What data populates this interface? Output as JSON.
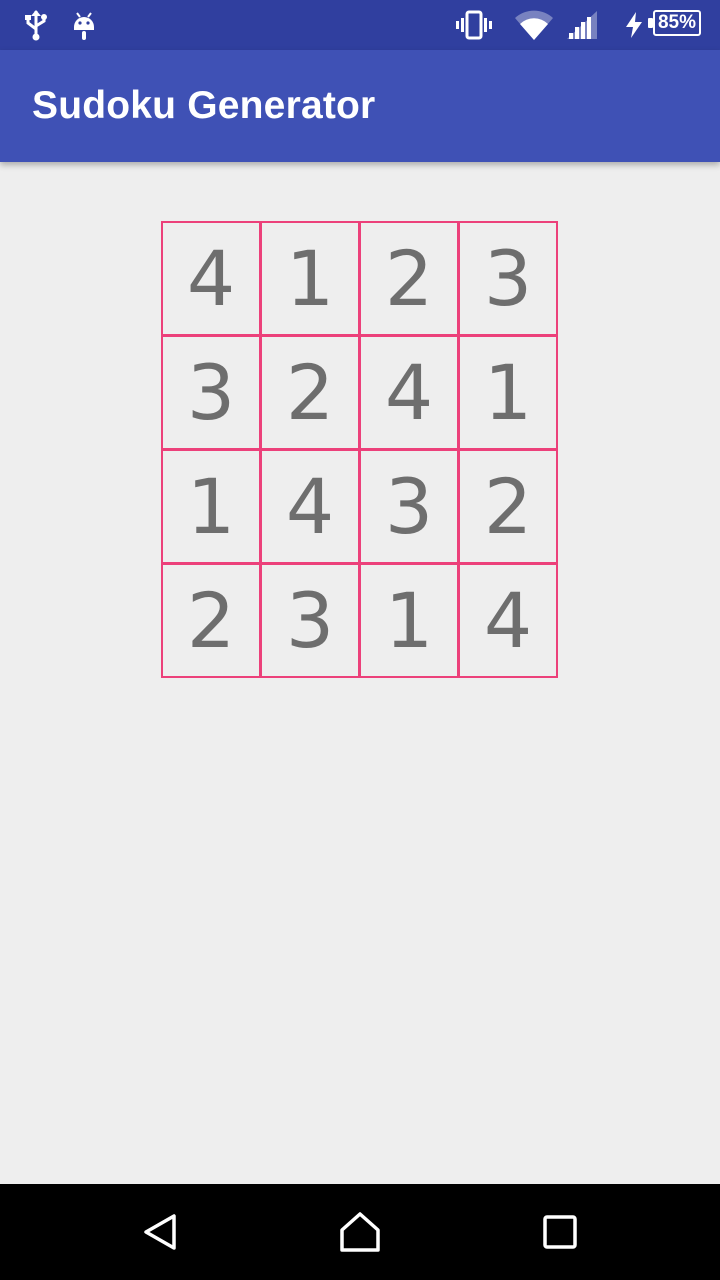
{
  "status_bar": {
    "battery": "85%",
    "icons": [
      "usb-icon",
      "android-debug-icon",
      "vibrate-icon",
      "wifi-icon",
      "signal-icon",
      "charging-icon",
      "battery-icon"
    ]
  },
  "app_bar": {
    "title": "Sudoku Generator",
    "color": "#3F51B5"
  },
  "sudoku": {
    "border_color": "#EC407A",
    "rows": [
      [
        "4",
        "1",
        "2",
        "3"
      ],
      [
        "3",
        "2",
        "4",
        "1"
      ],
      [
        "1",
        "4",
        "3",
        "2"
      ],
      [
        "2",
        "3",
        "1",
        "4"
      ]
    ]
  },
  "nav_bar": {
    "icons": [
      "back-icon",
      "home-icon",
      "recents-icon"
    ]
  }
}
